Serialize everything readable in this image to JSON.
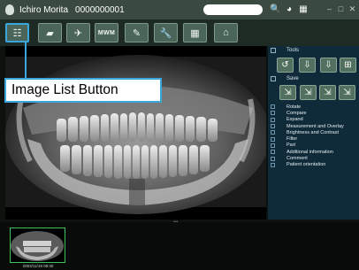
{
  "window": {
    "patient_name": "Ichiro Morita",
    "patient_id": "0000000001",
    "title_icons": [
      "zoom-icon",
      "contrast-icon",
      "grid-icon"
    ],
    "window_controls": [
      "minimize-icon",
      "restore-icon",
      "close-icon"
    ]
  },
  "toolbar": {
    "buttons": [
      {
        "name": "image-list-button",
        "glyph": "☷"
      },
      {
        "name": "image-view-button",
        "glyph": "▰"
      },
      {
        "name": "capture-button",
        "glyph": "✈"
      },
      {
        "name": "mwm-button",
        "glyph": "MWM"
      },
      {
        "name": "edit-button",
        "glyph": "✎"
      },
      {
        "name": "tools-button",
        "glyph": "🔧"
      },
      {
        "name": "layout-button",
        "glyph": "▦"
      },
      {
        "name": "home-button",
        "glyph": "⌂"
      }
    ]
  },
  "callout": {
    "label": "Image List Button"
  },
  "right_panel": {
    "tools_label": "Tools",
    "tools": [
      "↺",
      "⇩",
      "⇩",
      "⊞"
    ],
    "save_label": "Save",
    "save_tools": [
      "⇲",
      "⇲",
      "⇲",
      "⇲"
    ],
    "menu": [
      "Rotate",
      "Compare",
      "Expand",
      "Measurement and Overlay",
      "Brightness and Contrast",
      "Filter",
      "Part",
      "Additional information",
      "Comment",
      "Patient orientation"
    ]
  },
  "thumbnails": [
    {
      "date": "2003/11/19 09:30"
    }
  ],
  "colors": {
    "accent": "#3aa6dc",
    "thumb_border": "#3ec45a",
    "panel_bg": "#0f2a38"
  }
}
